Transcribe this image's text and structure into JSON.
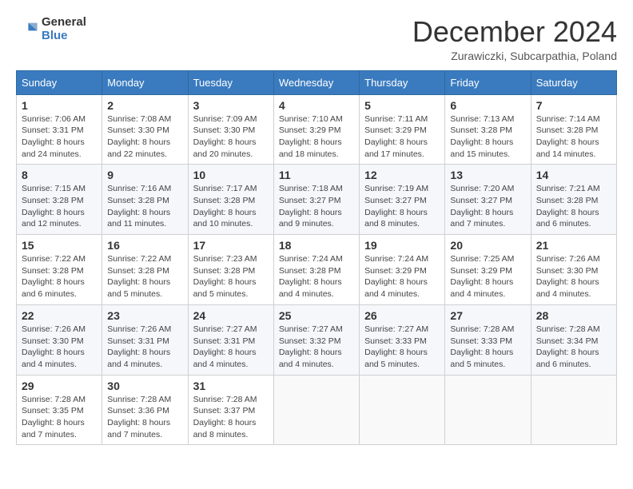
{
  "logo": {
    "general": "General",
    "blue": "Blue"
  },
  "header": {
    "month": "December 2024",
    "location": "Zurawiczki, Subcarpathia, Poland"
  },
  "weekdays": [
    "Sunday",
    "Monday",
    "Tuesday",
    "Wednesday",
    "Thursday",
    "Friday",
    "Saturday"
  ],
  "weeks": [
    [
      {
        "day": "1",
        "sunrise": "7:06 AM",
        "sunset": "3:31 PM",
        "daylight": "8 hours and 24 minutes."
      },
      {
        "day": "2",
        "sunrise": "7:08 AM",
        "sunset": "3:30 PM",
        "daylight": "8 hours and 22 minutes."
      },
      {
        "day": "3",
        "sunrise": "7:09 AM",
        "sunset": "3:30 PM",
        "daylight": "8 hours and 20 minutes."
      },
      {
        "day": "4",
        "sunrise": "7:10 AM",
        "sunset": "3:29 PM",
        "daylight": "8 hours and 18 minutes."
      },
      {
        "day": "5",
        "sunrise": "7:11 AM",
        "sunset": "3:29 PM",
        "daylight": "8 hours and 17 minutes."
      },
      {
        "day": "6",
        "sunrise": "7:13 AM",
        "sunset": "3:28 PM",
        "daylight": "8 hours and 15 minutes."
      },
      {
        "day": "7",
        "sunrise": "7:14 AM",
        "sunset": "3:28 PM",
        "daylight": "8 hours and 14 minutes."
      }
    ],
    [
      {
        "day": "8",
        "sunrise": "7:15 AM",
        "sunset": "3:28 PM",
        "daylight": "8 hours and 12 minutes."
      },
      {
        "day": "9",
        "sunrise": "7:16 AM",
        "sunset": "3:28 PM",
        "daylight": "8 hours and 11 minutes."
      },
      {
        "day": "10",
        "sunrise": "7:17 AM",
        "sunset": "3:28 PM",
        "daylight": "8 hours and 10 minutes."
      },
      {
        "day": "11",
        "sunrise": "7:18 AM",
        "sunset": "3:27 PM",
        "daylight": "8 hours and 9 minutes."
      },
      {
        "day": "12",
        "sunrise": "7:19 AM",
        "sunset": "3:27 PM",
        "daylight": "8 hours and 8 minutes."
      },
      {
        "day": "13",
        "sunrise": "7:20 AM",
        "sunset": "3:27 PM",
        "daylight": "8 hours and 7 minutes."
      },
      {
        "day": "14",
        "sunrise": "7:21 AM",
        "sunset": "3:28 PM",
        "daylight": "8 hours and 6 minutes."
      }
    ],
    [
      {
        "day": "15",
        "sunrise": "7:22 AM",
        "sunset": "3:28 PM",
        "daylight": "8 hours and 6 minutes."
      },
      {
        "day": "16",
        "sunrise": "7:22 AM",
        "sunset": "3:28 PM",
        "daylight": "8 hours and 5 minutes."
      },
      {
        "day": "17",
        "sunrise": "7:23 AM",
        "sunset": "3:28 PM",
        "daylight": "8 hours and 5 minutes."
      },
      {
        "day": "18",
        "sunrise": "7:24 AM",
        "sunset": "3:28 PM",
        "daylight": "8 hours and 4 minutes."
      },
      {
        "day": "19",
        "sunrise": "7:24 AM",
        "sunset": "3:29 PM",
        "daylight": "8 hours and 4 minutes."
      },
      {
        "day": "20",
        "sunrise": "7:25 AM",
        "sunset": "3:29 PM",
        "daylight": "8 hours and 4 minutes."
      },
      {
        "day": "21",
        "sunrise": "7:26 AM",
        "sunset": "3:30 PM",
        "daylight": "8 hours and 4 minutes."
      }
    ],
    [
      {
        "day": "22",
        "sunrise": "7:26 AM",
        "sunset": "3:30 PM",
        "daylight": "8 hours and 4 minutes."
      },
      {
        "day": "23",
        "sunrise": "7:26 AM",
        "sunset": "3:31 PM",
        "daylight": "8 hours and 4 minutes."
      },
      {
        "day": "24",
        "sunrise": "7:27 AM",
        "sunset": "3:31 PM",
        "daylight": "8 hours and 4 minutes."
      },
      {
        "day": "25",
        "sunrise": "7:27 AM",
        "sunset": "3:32 PM",
        "daylight": "8 hours and 4 minutes."
      },
      {
        "day": "26",
        "sunrise": "7:27 AM",
        "sunset": "3:33 PM",
        "daylight": "8 hours and 5 minutes."
      },
      {
        "day": "27",
        "sunrise": "7:28 AM",
        "sunset": "3:33 PM",
        "daylight": "8 hours and 5 minutes."
      },
      {
        "day": "28",
        "sunrise": "7:28 AM",
        "sunset": "3:34 PM",
        "daylight": "8 hours and 6 minutes."
      }
    ],
    [
      {
        "day": "29",
        "sunrise": "7:28 AM",
        "sunset": "3:35 PM",
        "daylight": "8 hours and 7 minutes."
      },
      {
        "day": "30",
        "sunrise": "7:28 AM",
        "sunset": "3:36 PM",
        "daylight": "8 hours and 7 minutes."
      },
      {
        "day": "31",
        "sunrise": "7:28 AM",
        "sunset": "3:37 PM",
        "daylight": "8 hours and 8 minutes."
      },
      null,
      null,
      null,
      null
    ]
  ],
  "labels": {
    "sunrise": "Sunrise:",
    "sunset": "Sunset:",
    "daylight": "Daylight:"
  }
}
